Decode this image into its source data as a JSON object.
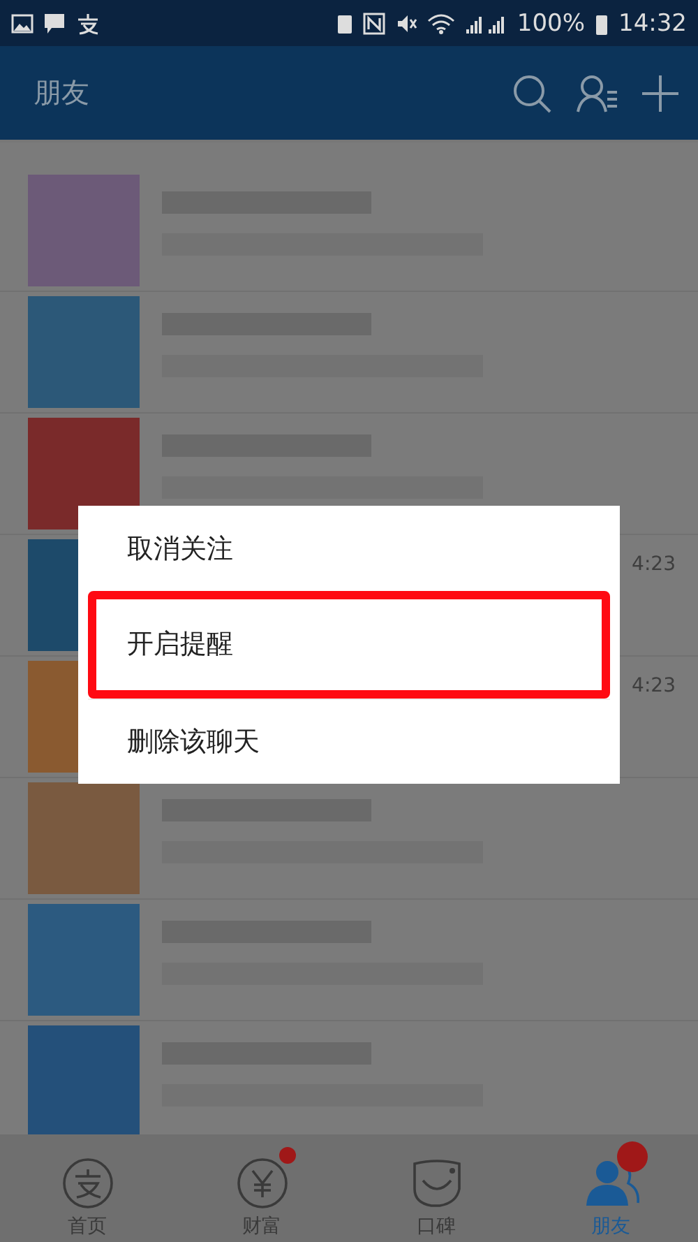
{
  "status_bar": {
    "battery": "100%",
    "time": "14:32"
  },
  "header": {
    "title": "朋友"
  },
  "rows": [
    {
      "color": "#6c5a78"
    },
    {
      "color": "#2c5878"
    },
    {
      "color": "#7a2a2a"
    },
    {
      "color": "#1d4a6a",
      "time": "4:23"
    },
    {
      "color": "#8a5a30",
      "time": "4:23"
    },
    {
      "color": "#7a5a40"
    },
    {
      "color": "#2c5a80"
    },
    {
      "color": "#24507a"
    }
  ],
  "menu": {
    "items": [
      {
        "label": "取消关注",
        "highlighted": false
      },
      {
        "label": "开启提醒",
        "highlighted": true
      },
      {
        "label": "删除该聊天",
        "highlighted": false
      }
    ]
  },
  "tabs": [
    {
      "label": "首页",
      "selected": false,
      "dot": false
    },
    {
      "label": "财富",
      "selected": false,
      "dot": true
    },
    {
      "label": "口碑",
      "selected": false,
      "dot": false
    },
    {
      "label": "朋友",
      "selected": true,
      "dot": true
    }
  ]
}
